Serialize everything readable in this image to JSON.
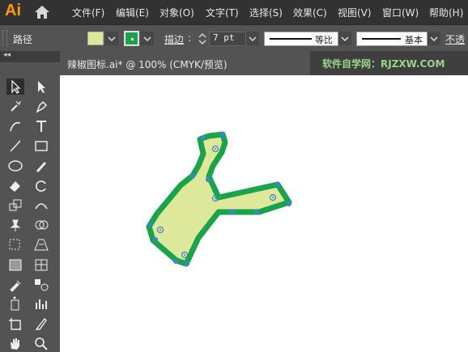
{
  "app": {
    "logo": "Ai"
  },
  "menu": [
    "文件(F)",
    "编辑(E)",
    "对象(O)",
    "文字(T)",
    "选择(S)",
    "效果(C)",
    "视图(V)",
    "窗口(W)",
    "帮助(H)"
  ],
  "control_bar": {
    "object_type": "路径",
    "stroke_label": "描边",
    "stroke_weight": "7 pt",
    "profile_label": "等比",
    "brush_label": "基本",
    "opacity_label": "不透"
  },
  "colors": {
    "fill": "#dde89b",
    "stroke": "#1aa34a",
    "anchor": "#3b82d6",
    "accent": "#ff9a00"
  },
  "document": {
    "tab_title": "辣椒图标.ai* @ 100% (CMYK/预览)",
    "watermark": "软件自学网：RJZXW.COM"
  },
  "tools": [
    "selection-tool",
    "direct-selection-tool",
    "magic-wand-tool",
    "pen-tool",
    "curvature-tool",
    "type-tool",
    "line-tool",
    "rectangle-tool",
    "ellipse-tool",
    "pencil-tool",
    "eraser-tool",
    "rotate-tool",
    "scale-tool",
    "puppet-warp-tool",
    "pin-tool",
    "shape-builder-tool",
    "free-transform-tool",
    "perspective-grid-tool",
    "gradient-tool",
    "mesh-tool",
    "eyedropper-tool",
    "blend-tool",
    "symbol-sprayer-tool",
    "column-graph-tool",
    "artboard-tool",
    "slice-tool",
    "hand-tool",
    "zoom-tool"
  ]
}
